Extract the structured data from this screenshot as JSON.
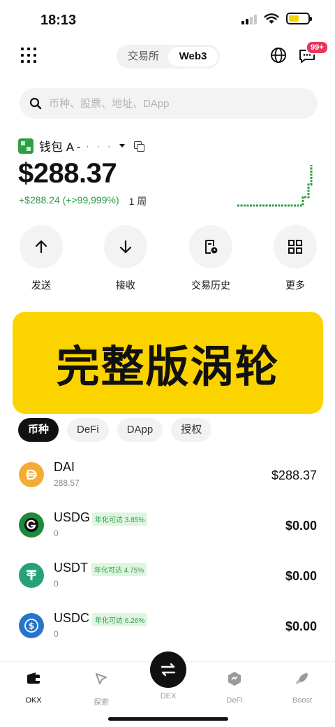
{
  "status_bar": {
    "time": "18:13",
    "battery_level": 0.55
  },
  "topbar": {
    "mode_options": [
      "交易所",
      "Web3"
    ],
    "active_mode": "Web3",
    "message_badge": "99+"
  },
  "search": {
    "placeholder": "币种、股票、地址、DApp"
  },
  "wallet": {
    "name": "钱包 A -",
    "masked_address": "· · ·",
    "balance": "$288.37",
    "change": "+$288.24 (+>99,999%)",
    "period": "1 周"
  },
  "actions": [
    {
      "label": "发送",
      "icon": "arrow-up-icon"
    },
    {
      "label": "接收",
      "icon": "arrow-down-icon"
    },
    {
      "label": "交易历史",
      "icon": "history-icon"
    },
    {
      "label": "更多",
      "icon": "apps-icon"
    }
  ],
  "banner": {
    "text": "完整版涡轮"
  },
  "tabs": [
    "币种",
    "DeFi",
    "DApp",
    "授权"
  ],
  "assets": [
    {
      "symbol": "DAI",
      "quantity": "288.57",
      "value": "$288.37",
      "apr": "",
      "color": "#f5ac37"
    },
    {
      "symbol": "USDG",
      "quantity": "0",
      "value": "$0.00",
      "apr": "年化可达 3.85%",
      "color": "#1f8a3a"
    },
    {
      "symbol": "USDT",
      "quantity": "0",
      "value": "$0.00",
      "apr": "年化可达 4.75%",
      "color": "#26a17b"
    },
    {
      "symbol": "USDC",
      "quantity": "0",
      "value": "$0.00",
      "apr": "年化可达 6.26%",
      "color": "#2775ca"
    }
  ],
  "bottom_nav": [
    {
      "label": "OKX",
      "icon": "wallet-icon",
      "active": true
    },
    {
      "label": "探索",
      "icon": "compass-icon",
      "active": false
    },
    {
      "label": "DEX",
      "icon": "swap-icon",
      "active": false
    },
    {
      "label": "DeFi",
      "icon": "defi-icon",
      "active": false
    },
    {
      "label": "Boost",
      "icon": "rocket-icon",
      "active": false
    }
  ],
  "colors": {
    "accent_green": "#2e9e46",
    "banner_yellow": "#fbd400",
    "badge_red": "#e8375c"
  }
}
